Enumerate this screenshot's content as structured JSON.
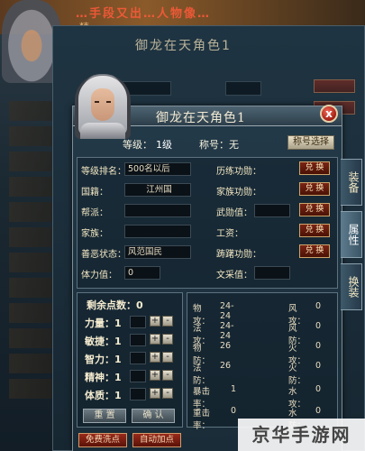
{
  "background": {
    "banner_text": "…手段又出…人物像…",
    "banner_text2": "精…",
    "panel_title": "御龙在天角色1",
    "left_col_labels": [
      "等",
      "国",
      "帮",
      "家",
      "善",
      "体"
    ]
  },
  "window": {
    "title": "御龙在天角色1",
    "close_glyph": "x",
    "level_label": "等级：",
    "level_value": "1级",
    "nick_label": "称号：",
    "nick_value": "无",
    "nick_button": "称号选择"
  },
  "side_tabs": [
    "装备",
    "属性",
    "换装"
  ],
  "info_rows": [
    {
      "label": "等级排名：",
      "value": "500名以后",
      "right_label": "历练功勋：",
      "button": "兑 换"
    },
    {
      "label": "国籍：",
      "value": "江州国",
      "right_label": "家族功勋：",
      "button": "兑 换"
    },
    {
      "label": "帮派：",
      "value": "",
      "right_label": "武勋值：",
      "button": "兑 换"
    },
    {
      "label": "家族：",
      "value": "",
      "right_label": "工资：",
      "button": "兑 换"
    },
    {
      "label": "善恶状态：",
      "value": "风范国民",
      "right_label": "踌躇功勋：",
      "button": "兑 换"
    },
    {
      "label": "体力值：",
      "value": "0",
      "right_label": "文采值：",
      "button": ""
    }
  ],
  "points": {
    "label": "剩余点数：",
    "value": "0",
    "plus": "+",
    "minus": "-",
    "stats": [
      {
        "label": "力量：",
        "value": "1"
      },
      {
        "label": "敏捷：",
        "value": "1"
      },
      {
        "label": "智力：",
        "value": "1"
      },
      {
        "label": "精神：",
        "value": "1"
      },
      {
        "label": "体质：",
        "value": "1"
      }
    ],
    "reset_button": "重 置",
    "confirm_button": "确 认"
  },
  "combat_stats_left": [
    {
      "label": "物攻：",
      "value": "24-24"
    },
    {
      "label": "法攻：",
      "value": "24-24"
    },
    {
      "label": "物防：",
      "value": "26"
    },
    {
      "label": "法防：",
      "value": "26"
    },
    {
      "label": "暴击率：",
      "value": "1"
    },
    {
      "label": "重击率：",
      "value": "0"
    }
  ],
  "combat_stats_right": [
    {
      "label": "风攻：",
      "value": "0"
    },
    {
      "label": "风防：",
      "value": "0"
    },
    {
      "label": "火攻：",
      "value": "0"
    },
    {
      "label": "火防：",
      "value": "0"
    },
    {
      "label": "水攻：",
      "value": "0"
    },
    {
      "label": "水防：",
      "value": "0"
    }
  ],
  "bottom_buttons": [
    "免费洗点",
    "自动加点"
  ],
  "watermark": "京华手游网",
  "colors": {
    "panel": "#1a2c38",
    "accent_red": "#7a2414",
    "text": "#f3e7c3"
  }
}
